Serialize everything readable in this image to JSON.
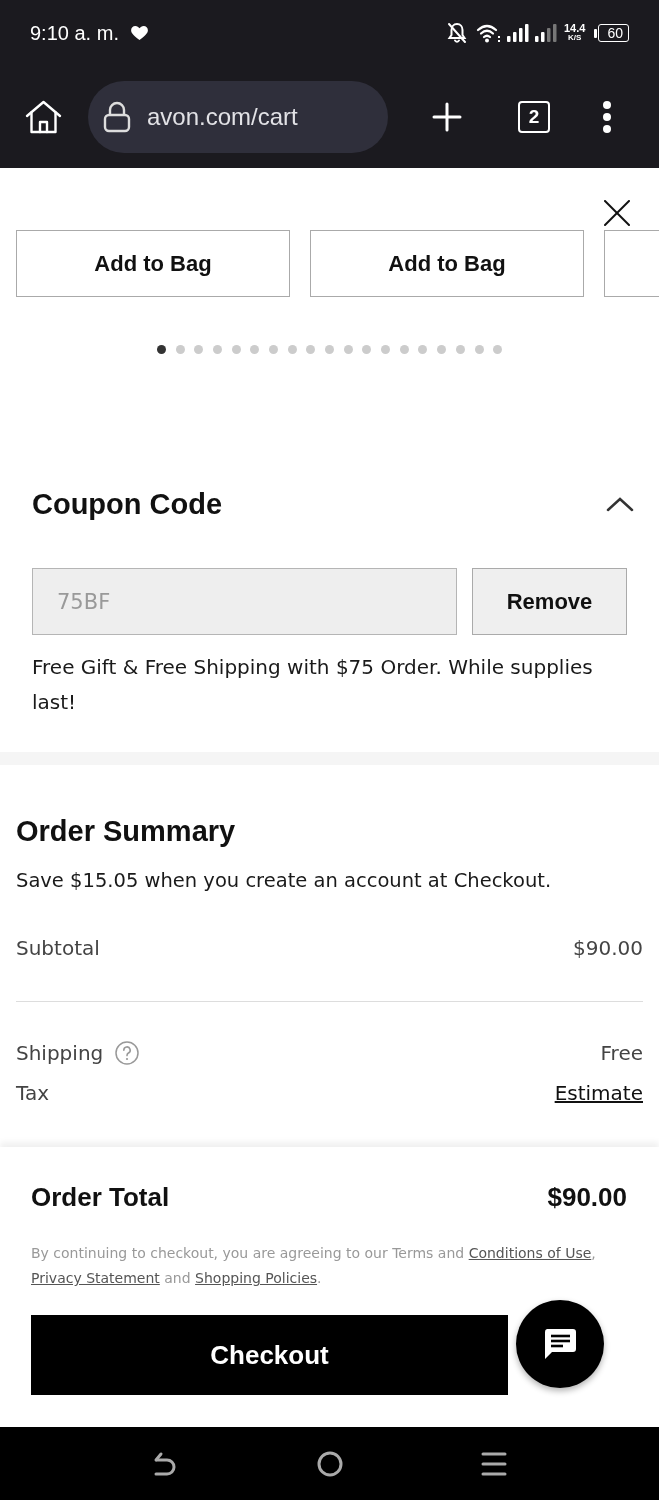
{
  "status_bar": {
    "time": "9:10 a. m.",
    "network_speed": "14.4",
    "speed_unit": "K/S",
    "battery": "60"
  },
  "browser": {
    "url": "avon.com/cart",
    "tab_count": "2"
  },
  "carousel": {
    "buttons": [
      "Add to Bag",
      "Add to Bag"
    ],
    "next_card_peek": true,
    "dots": [
      {
        "selected": true
      },
      {
        "selected": false
      },
      {
        "selected": false
      },
      {
        "selected": false
      },
      {
        "selected": false
      },
      {
        "selected": false
      },
      {
        "selected": false
      },
      {
        "selected": false
      },
      {
        "selected": false
      },
      {
        "selected": false
      },
      {
        "selected": false
      },
      {
        "selected": false
      },
      {
        "selected": false
      },
      {
        "selected": false
      },
      {
        "selected": false
      },
      {
        "selected": false
      },
      {
        "selected": false
      },
      {
        "selected": false
      },
      {
        "selected": false
      }
    ]
  },
  "coupon": {
    "title": "Coupon Code",
    "expanded": true,
    "field": {
      "value": "75BF",
      "disabled": true
    },
    "button": "Remove",
    "message": "Free Gift & Free Shipping with $75 Order. While supplies last!"
  },
  "order_summary": {
    "title": "Order Summary",
    "promo": "Save $15.05 when you create an account at Checkout.",
    "groups": [
      {
        "rows": [
          {
            "label": "Subtotal",
            "value": "$90.00",
            "kind": "plain"
          }
        ]
      },
      {
        "rows": [
          {
            "label": "Shipping",
            "value": "Free",
            "kind": "help"
          },
          {
            "label": "Tax",
            "value": "Estimate",
            "kind": "link"
          }
        ]
      }
    ]
  },
  "footer": {
    "total_label": "Order Total",
    "total": "$90.00",
    "legal": [
      {
        "text": "By continuing to checkout, you are agreeing to our Terms and ",
        "kind": "text"
      },
      {
        "text": "Conditions of Use",
        "kind": "link"
      },
      {
        "text": ", ",
        "kind": "text"
      },
      {
        "text": "Privacy Statement",
        "kind": "link"
      },
      {
        "text": " and ",
        "kind": "text"
      },
      {
        "text": "Shopping Policies",
        "kind": "link"
      },
      {
        "text": ".",
        "kind": "text"
      }
    ],
    "checkout": "Checkout"
  }
}
